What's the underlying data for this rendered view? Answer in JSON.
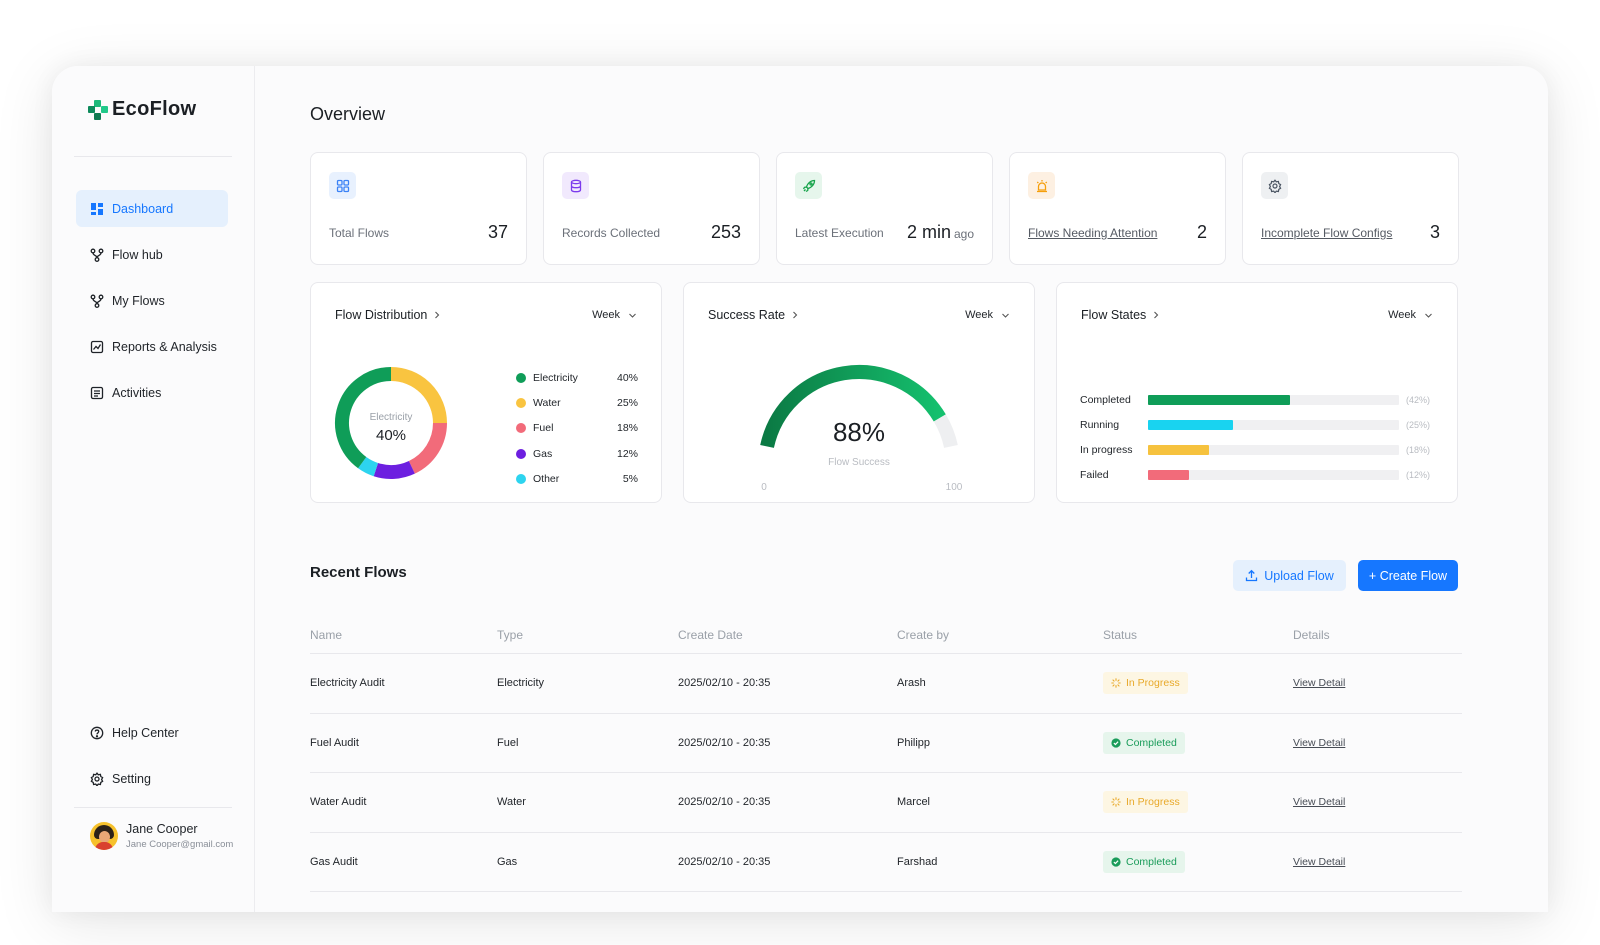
{
  "app": {
    "name": "EcoFlow"
  },
  "sidebar": {
    "items": [
      {
        "label": "Dashboard",
        "icon": "dashboard-icon",
        "active": true
      },
      {
        "label": "Flow hub",
        "icon": "flow-hub-icon"
      },
      {
        "label": "My Flows",
        "icon": "my-flows-icon"
      },
      {
        "label": "Reports & Analysis",
        "icon": "reports-icon"
      },
      {
        "label": "Activities",
        "icon": "activities-icon"
      }
    ],
    "bottom_items": [
      {
        "label": "Help Center",
        "icon": "help-icon"
      },
      {
        "label": "Setting",
        "icon": "settings-icon"
      }
    ],
    "user": {
      "name": "Jane Cooper",
      "email": "Jane Cooper@gmail.com"
    }
  },
  "overview": {
    "title": "Overview",
    "stats": [
      {
        "label": "Total Flows",
        "value": "37",
        "icon": "grid-icon",
        "color": "#3b82f6"
      },
      {
        "label": "Records Collected",
        "value": "253",
        "icon": "database-icon",
        "color": "#7c3aed"
      },
      {
        "label": "Latest Execution",
        "value": "2 min",
        "unit": "ago",
        "icon": "rocket-icon",
        "color": "#16a34a"
      },
      {
        "label": "Flows Needing Attention",
        "value": "2",
        "icon": "alarm-icon",
        "color": "#f59e0b"
      },
      {
        "label": "Incomplete Flow Configs",
        "value": "3",
        "icon": "gear-icon",
        "color": "#4b5563"
      }
    ]
  },
  "charts": {
    "distribution": {
      "title": "Flow Distribution",
      "period": "Week",
      "center_label": "Electricity",
      "center_value": "40%"
    },
    "success": {
      "title": "Success Rate",
      "period": "Week",
      "value_text": "88%",
      "caption": "Flow Success",
      "min_label": "0",
      "max_label": "100"
    },
    "states": {
      "title": "Flow States",
      "period": "Week"
    }
  },
  "chart_data": [
    {
      "type": "pie",
      "title": "Flow Distribution",
      "categories": [
        "Electricity",
        "Water",
        "Fuel",
        "Gas",
        "Other"
      ],
      "values": [
        40,
        25,
        18,
        12,
        5
      ],
      "labels": [
        "40%",
        "25%",
        "18%",
        "12%",
        "5%"
      ],
      "colors": [
        "#0f9d58",
        "#f9c440",
        "#f26b7a",
        "#6d1fe0",
        "#2dd4ef"
      ],
      "center_label": "Electricity",
      "center_value": "40%"
    },
    {
      "type": "gauge",
      "title": "Success Rate",
      "value": 88,
      "range": [
        0,
        100
      ]
    },
    {
      "type": "bar",
      "title": "Flow States",
      "categories": [
        "Completed",
        "Running",
        "In progress",
        "Failed"
      ],
      "values": [
        42,
        25,
        18,
        12
      ],
      "labels": [
        "(42%)",
        "(25%)",
        "(18%)",
        "(12%)"
      ],
      "colors": [
        "#0f9d58",
        "#19d3f0",
        "#f6c23e",
        "#f26b7a"
      ],
      "xlim": [
        0,
        74
      ]
    }
  ],
  "recent": {
    "title": "Recent Flows",
    "upload_label": "Upload Flow",
    "create_label": "+ Create Flow",
    "columns": [
      "Name",
      "Type",
      "Create Date",
      "Create by",
      "Status",
      "Details"
    ],
    "rows": [
      {
        "name": "Electricity Audit",
        "type": "Electricity",
        "date": "2025/02/10 - 20:35",
        "by": "Arash",
        "status": "In Progress",
        "state": "progress",
        "detail": "View Detail"
      },
      {
        "name": "Fuel Audit",
        "type": "Fuel",
        "date": "2025/02/10 - 20:35",
        "by": "Philipp",
        "status": "Completed",
        "state": "done",
        "detail": "View Detail"
      },
      {
        "name": "Water Audit",
        "type": "Water",
        "date": "2025/02/10 - 20:35",
        "by": "Marcel",
        "status": "In Progress",
        "state": "progress",
        "detail": "View Detail"
      },
      {
        "name": "Gas Audit",
        "type": "Gas",
        "date": "2025/02/10 - 20:35",
        "by": "Farshad",
        "status": "Completed",
        "state": "done",
        "detail": "View Detail"
      }
    ]
  }
}
